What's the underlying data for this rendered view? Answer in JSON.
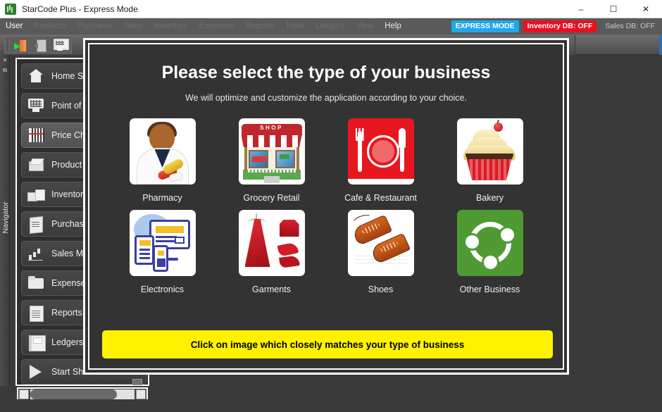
{
  "window": {
    "title": "StarCode Plus - Express Mode",
    "app_icon": "barcode-app-icon",
    "controls": {
      "minimize": "–",
      "maximize": "☐",
      "close": "✕"
    }
  },
  "menubar": {
    "items": [
      {
        "label": "User",
        "state": "active"
      },
      {
        "label": "Products",
        "state": "dim"
      },
      {
        "label": "Purchase",
        "state": "dim"
      },
      {
        "label": "Sales",
        "state": "dim"
      },
      {
        "label": "Inventory",
        "state": "dim"
      },
      {
        "label": "Expenses",
        "state": "dim"
      },
      {
        "label": "Reports",
        "state": "dim"
      },
      {
        "label": "Tools",
        "state": "dim"
      },
      {
        "label": "Ledgers",
        "state": "dim"
      },
      {
        "label": "View",
        "state": "dim"
      },
      {
        "label": "Help",
        "state": "lit"
      }
    ],
    "badges": [
      {
        "label": "EXPRESS MODE",
        "color": "#20a8e8",
        "kind": "express"
      },
      {
        "label": "Inventory DB: OFF",
        "color": "#e81020",
        "kind": "invdb"
      },
      {
        "label": "Sales DB: OFF",
        "color": "#c9c9c9",
        "kind": "salesdb"
      }
    ]
  },
  "toolbar": {
    "buttons": [
      {
        "icon": "login-door-icon",
        "name": "login-button"
      },
      {
        "icon": "logout-door-icon",
        "name": "logout-button"
      },
      {
        "icon": "pos-monitor-icon",
        "name": "point-of-sale-button"
      }
    ]
  },
  "dock": {
    "label": "Navigator",
    "buttons": [
      "✕",
      "⧉"
    ]
  },
  "navigator": {
    "items": [
      {
        "label": "Home Sc",
        "icon": "home-icon",
        "glyph": "g-home",
        "selected": false
      },
      {
        "label": "Point of S",
        "icon": "point-of-sale-icon",
        "glyph": "g-pos",
        "selected": false
      },
      {
        "label": "Price Che",
        "icon": "barcode-icon",
        "glyph": "g-barcode",
        "selected": true
      },
      {
        "label": "Product",
        "icon": "product-box-icon",
        "glyph": "g-box",
        "selected": false
      },
      {
        "label": "Inventor",
        "icon": "inventory-boxes-icon",
        "glyph": "g-boxes",
        "selected": false
      },
      {
        "label": "Purchase",
        "icon": "purchase-invoice-icon",
        "glyph": "g-invoice",
        "selected": false
      },
      {
        "label": "Sales Ma",
        "icon": "sales-chart-icon",
        "glyph": "g-chart",
        "selected": false
      },
      {
        "label": "Expense",
        "icon": "expense-folder-icon",
        "glyph": "g-folder",
        "selected": false
      },
      {
        "label": "Reports",
        "icon": "report-document-icon",
        "glyph": "g-report",
        "selected": false
      },
      {
        "label": "Ledgers",
        "icon": "ledger-book-icon",
        "glyph": "g-ledger",
        "selected": false
      },
      {
        "label": "Start Shi",
        "icon": "play-icon",
        "glyph": "g-play",
        "selected": false
      }
    ],
    "scrollbar": {
      "left_arrow": "◀",
      "right_arrow": "▶",
      "thumb_percent": 83
    }
  },
  "dialog": {
    "title": "Please select the type of your business",
    "subtitle": "We will optimize and customize the application according to your choice.",
    "banner": "Click on image which closely matches your type of business",
    "banner_color": "#fff200",
    "background_color": "#333333",
    "options": [
      {
        "label": "Pharmacy",
        "icon": "pharmacist-icon",
        "art": "art-pharmacy"
      },
      {
        "label": "Grocery Retail",
        "icon": "shop-storefront-icon",
        "art": "art-shop",
        "sign": "SHOP"
      },
      {
        "label": "Cafe & Restaurant",
        "icon": "cutlery-plate-icon",
        "art": "art-cafe"
      },
      {
        "label": "Bakery",
        "icon": "cupcake-icon",
        "art": "art-bakery"
      },
      {
        "label": "Electronics",
        "icon": "devices-icon",
        "art": "art-elec"
      },
      {
        "label": "Garments",
        "icon": "dress-icon",
        "art": "art-garm"
      },
      {
        "label": "Shoes",
        "icon": "shoes-icon",
        "art": "art-shoes"
      },
      {
        "label": "Other Business",
        "icon": "network-nodes-icon",
        "art": "art-other"
      }
    ]
  }
}
